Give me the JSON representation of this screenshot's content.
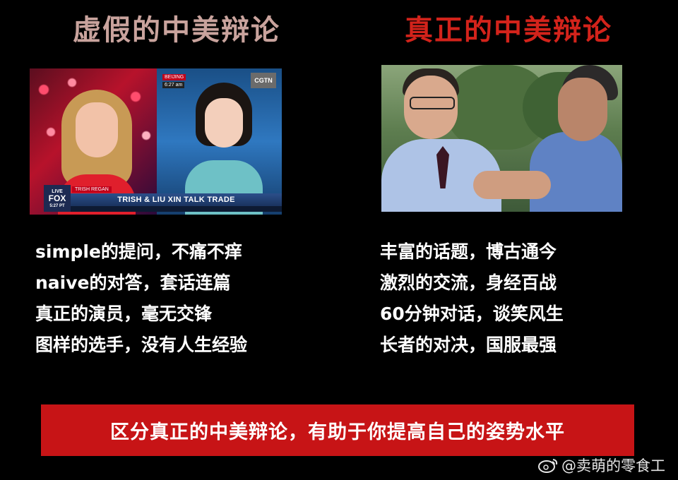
{
  "left": {
    "title": "虚假的中美辩论",
    "photo": {
      "tv_overlay": {
        "beijing_tag": "BEIJING",
        "beijing_time": "6:27 am",
        "channel_logo": "CGTN",
        "live_label": "LIVE",
        "fox_label": "FOX",
        "fox_time": "5:27 PT",
        "lower_name": "TRISH REGAN",
        "lower_bar": "TRISH & LIU XIN TALK TRADE"
      }
    },
    "lines": [
      "simple的提问，不痛不痒",
      "naive的对答，套话连篇",
      "真正的演员，毫无交锋",
      "图样的选手，没有人生经验"
    ]
  },
  "right": {
    "title": "真正的中美辩论",
    "lines": [
      "丰富的话题，博古通今",
      "激烈的交流，身经百战",
      "60分钟对话，谈笑风生",
      "长者的对决，国服最强"
    ]
  },
  "banner": {
    "text": "区分真正的中美辩论，有助于你提高自己的姿势水平"
  },
  "watermark": {
    "text": "@卖萌的零食工",
    "icon": "weibo-icon"
  },
  "colors": {
    "background": "#000000",
    "left_title": "#c9a39d",
    "right_title": "#d3231b",
    "banner": "#c71416"
  }
}
